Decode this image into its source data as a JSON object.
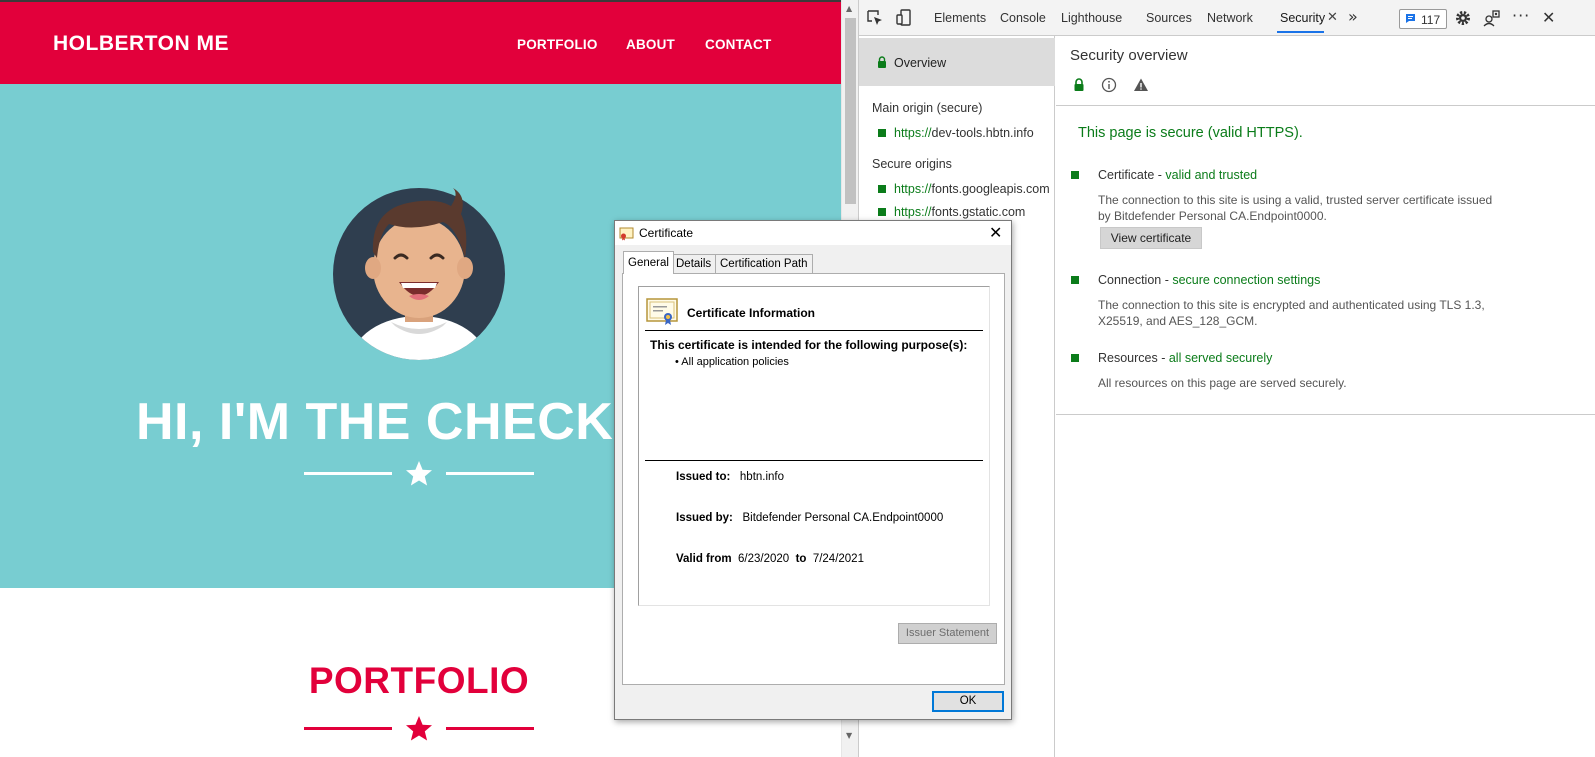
{
  "site": {
    "brand": "HOLBERTON ME",
    "nav": [
      "PORTFOLIO",
      "ABOUT",
      "CONTACT"
    ],
    "hero_title": "HI, I'M THE CHECK",
    "portfolio_title": "PORTFOLIO",
    "colors": {
      "primary": "#e2003b",
      "hero_bg": "#78cdd1"
    }
  },
  "devtools": {
    "tabs": [
      "Elements",
      "Console",
      "Lighthouse",
      "Sources",
      "Network",
      "Security"
    ],
    "active_tab": "Security",
    "issues_count": "117",
    "sidebar": {
      "overview": "Overview",
      "main_origin_header": "Main origin (secure)",
      "main_origin": {
        "scheme": "https://",
        "host": "dev-tools.hbtn.info"
      },
      "secure_origins_header": "Secure origins",
      "secure_origins": [
        {
          "scheme": "https://",
          "host": "fonts.googleapis.com"
        },
        {
          "scheme": "https://",
          "host": "fonts.gstatic.com"
        }
      ]
    },
    "overview": {
      "title": "Security overview",
      "verdict": "This page is secure (valid HTTPS).",
      "items": [
        {
          "name": "Certificate",
          "status": "valid and trusted",
          "description": "The connection to this site is using a valid, trusted server certificate issued by Bitdefender Personal CA.Endpoint0000.",
          "button": "View certificate"
        },
        {
          "name": "Connection",
          "status": "secure connection settings",
          "description": "The connection to this site is encrypted and authenticated using TLS 1.3, X25519, and AES_128_GCM."
        },
        {
          "name": "Resources",
          "status": "all served securely",
          "description": "All resources on this page are served securely."
        }
      ],
      "colors": {
        "secure_green": "#0b7c1a",
        "accent_blue": "#1a73e8"
      }
    }
  },
  "certificate_dialog": {
    "title": "Certificate",
    "tabs": [
      "General",
      "Details",
      "Certification Path"
    ],
    "info_title": "Certificate Information",
    "purpose_heading": "This certificate is intended for the following purpose(s):",
    "purposes": [
      "• All application policies"
    ],
    "issued_to_label": "Issued to:",
    "issued_to": "hbtn.info",
    "issued_by_label": "Issued by:",
    "issued_by": "Bitdefender Personal CA.Endpoint0000",
    "valid_from_label": "Valid from",
    "valid_from": "6/23/2020",
    "to_label": "to",
    "valid_to": "7/24/2021",
    "issuer_statement_button": "Issuer Statement",
    "ok_button": "OK"
  }
}
